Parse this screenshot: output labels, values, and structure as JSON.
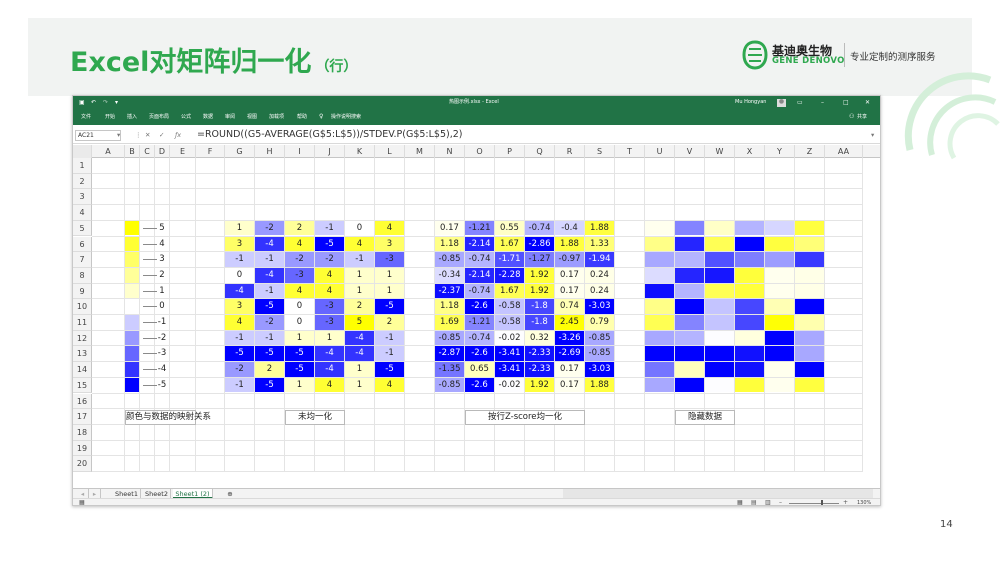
{
  "slide": {
    "title": "Excel对矩阵归一化",
    "title_suffix": "（行）",
    "logo_cn": "基迪奥生物",
    "logo_en": "GENE DENOVO",
    "logo_tagline": "专业定制的测序服务",
    "page_number": "14"
  },
  "excel": {
    "window_title": "热图示例.xlsx - Excel",
    "user_name": "Mu Hongyan",
    "share_label": "共享",
    "ribbon_tabs": [
      "文件",
      "开始",
      "插入",
      "页面布局",
      "公式",
      "数据",
      "审阅",
      "视图",
      "加载项",
      "帮助",
      "操作说明搜索"
    ],
    "name_box": "AC21",
    "formula": "=ROUND((G5-AVERAGE(G$5:L$5))/STDEV.P(G$5:L$5),2)",
    "columns": [
      "A",
      "B",
      "C",
      "D",
      "E",
      "F",
      "G",
      "H",
      "I",
      "J",
      "K",
      "L",
      "M",
      "N",
      "O",
      "P",
      "Q",
      "R",
      "S",
      "T",
      "U",
      "V",
      "W",
      "X",
      "Y",
      "Z",
      "AA"
    ],
    "rows": [
      "1",
      "2",
      "3",
      "4",
      "5",
      "6",
      "7",
      "8",
      "9",
      "10",
      "11",
      "12",
      "13",
      "14",
      "15",
      "16",
      "17",
      "18",
      "19",
      "20"
    ],
    "legend_values": [
      "5",
      "4",
      "3",
      "2",
      "1",
      "0",
      "-1",
      "-2",
      "-3",
      "-4",
      "-5"
    ],
    "raw_matrix": [
      [
        "1",
        "-2",
        "2",
        "-1",
        "0",
        "4"
      ],
      [
        "3",
        "-4",
        "4",
        "-5",
        "4",
        "3"
      ],
      [
        "-1",
        "-1",
        "-2",
        "-2",
        "-1",
        "-3"
      ],
      [
        "0",
        "-4",
        "-3",
        "4",
        "1",
        "1"
      ],
      [
        "-4",
        "-1",
        "4",
        "4",
        "1",
        "1"
      ],
      [
        "3",
        "-5",
        "0",
        "-3",
        "2",
        "-5"
      ],
      [
        "4",
        "-2",
        "0",
        "-3",
        "5",
        "2"
      ],
      [
        "-1",
        "-1",
        "1",
        "1",
        "-4",
        "-1"
      ],
      [
        "-5",
        "-5",
        "-5",
        "-4",
        "-4",
        "-1"
      ],
      [
        "-2",
        "2",
        "-5",
        "-4",
        "1",
        "-5"
      ],
      [
        "-1",
        "-5",
        "1",
        "4",
        "1",
        "4"
      ]
    ],
    "zscore_matrix": [
      [
        "0.17",
        "-1.21",
        "0.55",
        "-0.74",
        "-0.4",
        "1.88"
      ],
      [
        "1.18",
        "-2.14",
        "1.67",
        "-2.86",
        "1.88",
        "1.33"
      ],
      [
        "-0.85",
        "-0.74",
        "-1.71",
        "-1.27",
        "-0.97",
        "-1.94"
      ],
      [
        "-0.34",
        "-2.14",
        "-2.28",
        "1.92",
        "0.17",
        "0.24"
      ],
      [
        "-2.37",
        "-0.74",
        "1.67",
        "1.92",
        "0.17",
        "0.24"
      ],
      [
        "1.18",
        "-2.6",
        "-0.58",
        "-1.8",
        "0.74",
        "-3.03"
      ],
      [
        "1.69",
        "-1.21",
        "-0.58",
        "-1.8",
        "2.45",
        "0.79"
      ],
      [
        "-0.85",
        "-0.74",
        "-0.02",
        "0.32",
        "-3.26",
        "-0.85"
      ],
      [
        "-2.87",
        "-2.6",
        "-3.41",
        "-2.33",
        "-2.69",
        "-0.85"
      ],
      [
        "-1.35",
        "0.65",
        "-3.41",
        "-2.33",
        "0.17",
        "-3.03"
      ],
      [
        "-0.85",
        "-2.6",
        "-0.02",
        "1.92",
        "0.17",
        "1.88"
      ]
    ],
    "labels": {
      "legend": "颜色与数据的映射关系",
      "raw": "未均一化",
      "zscore": "按行Z-score均一化",
      "hidden": "隐藏数据"
    },
    "sheet_tabs": [
      "Sheet1",
      "Sheet2",
      "Sheet1 (2)"
    ],
    "active_sheet": "Sheet1 (2)",
    "zoom": "130%"
  },
  "colors": {
    "brand_green": "#2fa84f",
    "excel_green": "#217346",
    "positive": "#ffff00",
    "negative": "#0000ff",
    "neutral": "#ffffff"
  }
}
